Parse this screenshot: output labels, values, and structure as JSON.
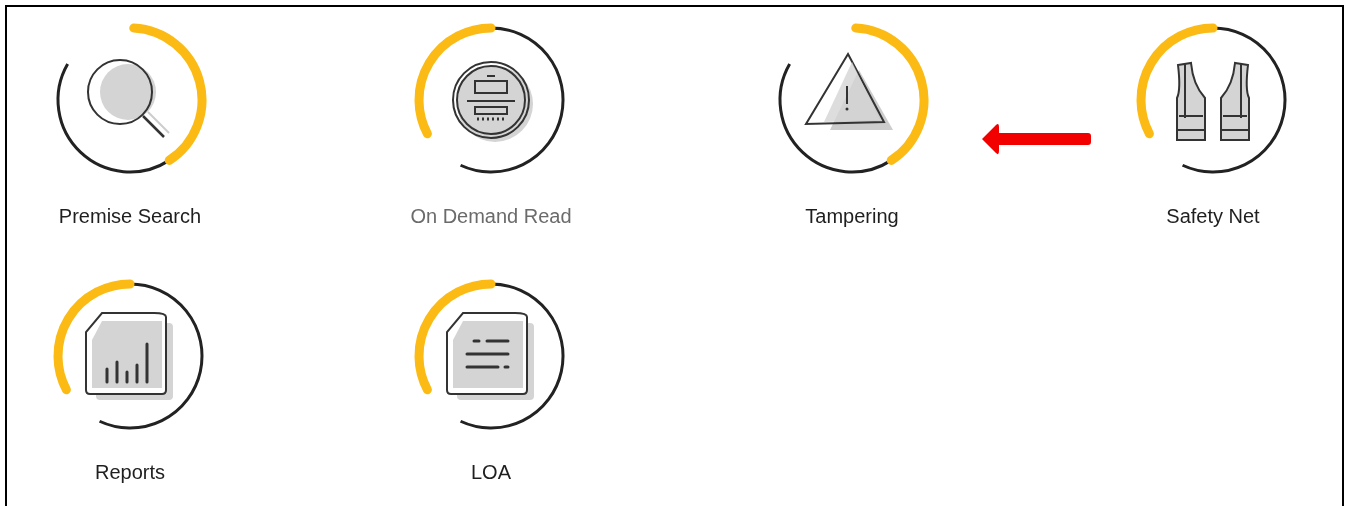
{
  "tiles": [
    {
      "label": "Premise Search",
      "kind": "search",
      "disabled": false
    },
    {
      "label": "On Demand Read",
      "kind": "meter",
      "disabled": true
    },
    {
      "label": "Tampering",
      "kind": "warning",
      "disabled": false
    },
    {
      "label": "Safety Net",
      "kind": "vest",
      "disabled": false
    },
    {
      "label": "Reports",
      "kind": "chart",
      "disabled": false
    },
    {
      "label": "LOA",
      "kind": "document",
      "disabled": false
    }
  ]
}
